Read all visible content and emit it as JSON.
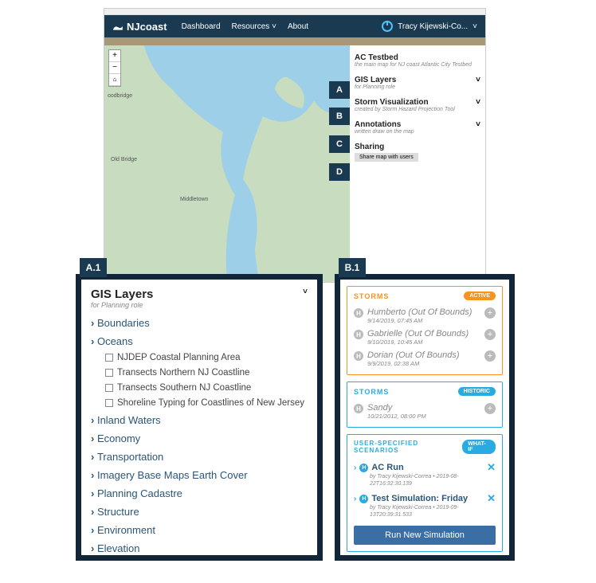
{
  "nav": {
    "brand": "NJcoast",
    "items": [
      "Dashboard",
      "Resources",
      "About"
    ],
    "user": "Tracy Kijewski-Co..."
  },
  "map": {
    "labels": {
      "oldbridge": "Old Bridge",
      "middletown": "Middletown",
      "woodbridge": "oodbridge"
    }
  },
  "side": {
    "testbed": {
      "title": "AC Testbed",
      "sub": "the main map for NJ coast Atlantic City Testbed"
    },
    "a": {
      "title": "GIS Layers",
      "sub": "for Planning role"
    },
    "b": {
      "title": "Storm Visualization",
      "sub": "created by Storm Hazard Projection Tool"
    },
    "c": {
      "title": "Annotations",
      "sub": "written draw on the map"
    },
    "d": {
      "title": "Sharing",
      "btn": "Share map with users"
    }
  },
  "badges": {
    "a": "A",
    "b": "B",
    "c": "C",
    "d": "D",
    "a1": "A.1",
    "b1": "B.1"
  },
  "a1": {
    "title": "GIS Layers",
    "sub": "for Planning role",
    "cats_top": [
      "Boundaries",
      "Oceans"
    ],
    "oceans_items": [
      "NJDEP Coastal Planning Area",
      "Transects Northern NJ Coastline",
      "Transects Southern NJ Coastline",
      "Shoreline Typing for Coastlines of New Jersey"
    ],
    "cats_rest": [
      "Inland Waters",
      "Economy",
      "Transportation",
      "Imagery Base Maps Earth Cover",
      "Planning Cadastre",
      "Structure",
      "Environment",
      "Elevation"
    ]
  },
  "b1": {
    "storms_label": "STORMS",
    "active": "ACTIVE",
    "historic": "HISTORIC",
    "active_storms": [
      {
        "name": "Humberto (Out Of Bounds)",
        "date": "9/14/2019, 07:45 AM"
      },
      {
        "name": "Gabrielle (Out Of Bounds)",
        "date": "9/10/2019, 10:45 AM"
      },
      {
        "name": "Dorian (Out Of Bounds)",
        "date": "9/9/2019, 02:38 AM"
      }
    ],
    "historic_storms": [
      {
        "name": "Sandy",
        "date": "10/21/2012, 08:00 PM"
      }
    ],
    "user_label": "USER-SPECIFIED SCENARIOS",
    "whatif": "WHAT-IF",
    "scenarios": [
      {
        "name": "AC Run",
        "meta": "by Tracy Kijewski-Correa • 2019-08-22T16:32:30.139"
      },
      {
        "name": "Test Simulation: Friday",
        "meta": "by Tracy Kijewski-Correa • 2019-09-13T20:39:31.533"
      }
    ],
    "run": "Run New Simulation"
  }
}
